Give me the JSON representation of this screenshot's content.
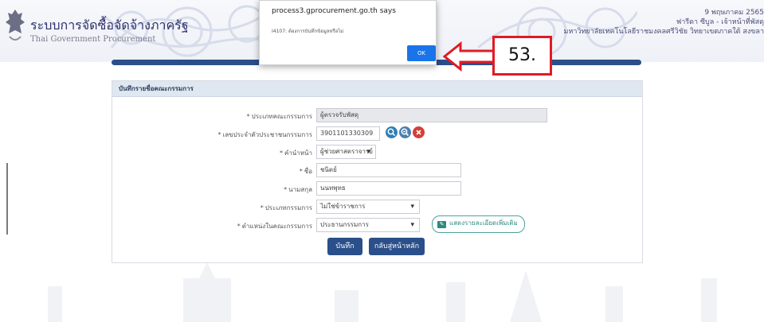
{
  "header": {
    "title": "ระบบการจัดซื้อจัดจ้างภาครัฐ",
    "subtitle": "Thai Government Procurement",
    "date": "9 พฤษภาคม 2565",
    "user": "ฟารีดา ซีบูล - เจ้าหน้าที่พัสดุ",
    "org": "มหาวิทยาลัยเทคโนโลยีราชมงคลศรีวิชัย วิทยาเขตภาคใต้ สงขลา"
  },
  "panel": {
    "title": "บันทึกรายชื่อคณะกรรมการ",
    "fields": {
      "committee_type": {
        "label": "ประเภทคณะกรรมการ",
        "value": "ผู้ตรวจรับพัสดุ"
      },
      "national_id": {
        "label": "เลขประจำตัวประชาชนกรรมการ",
        "value": "3901101330309"
      },
      "prefix": {
        "label": "คำนำหน้า",
        "value": "ผู้ช่วยศาสตราจารย์"
      },
      "first_name": {
        "label": "ชื่อ",
        "value": "ชนิตย์"
      },
      "last_name": {
        "label": "นามสกุล",
        "value": "นนทพุทธ"
      },
      "member_type": {
        "label": "ประเภทกรรมการ",
        "value": "ไม่ใช่ข้าราชการ"
      },
      "position": {
        "label": "ตำแหน่งในคณะกรรมการ",
        "value": "ประธานกรรมการ"
      }
    },
    "required_mark": "*",
    "more_details_label": "แสดงรายละเอียดเพิ่มเติม",
    "save_label": "บันทึก",
    "back_label": "กลับสู่หน้าหลัก"
  },
  "dialog": {
    "title": "process3.gprocurement.go.th says",
    "message": "I4107: ต้องการบันทึกข้อมูลหรือไม่",
    "ok_label": "OK"
  },
  "annotation": {
    "step": "53."
  },
  "colors": {
    "primary": "#2a4f8a",
    "dialog_ok": "#1a73e8",
    "callout_border": "#e01b24",
    "teal": "#2b8a80"
  }
}
